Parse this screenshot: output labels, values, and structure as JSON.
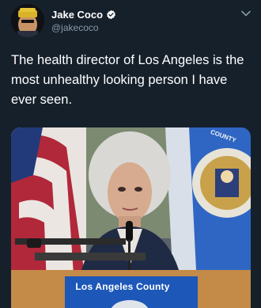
{
  "tweet": {
    "display_name": "Jake Coco",
    "handle": "@jakecoco",
    "text": "The health director of Los Angeles is the most unhealthy looking person I have ever seen."
  },
  "media": {
    "podium_label": "Los Angeles County",
    "seal_text": "COUNTY"
  },
  "icons": {
    "verified": "verified-badge-icon",
    "more": "chevron-down-icon"
  },
  "colors": {
    "background": "#15202b",
    "secondary_text": "#8899a6",
    "verified": "#ffffff",
    "podium_blue": "#1d57b8"
  }
}
